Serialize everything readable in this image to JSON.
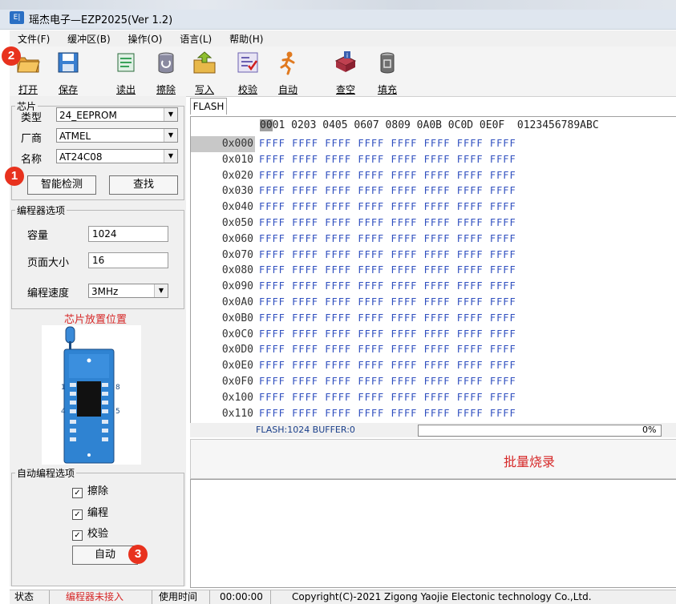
{
  "window": {
    "app_icon": "ezp-app-icon",
    "title": "瑶杰电子—EZP2025(Ver 1.2)"
  },
  "menu": [
    "文件(F)",
    "缓冲区(B)",
    "操作(O)",
    "语言(L)",
    "帮助(H)"
  ],
  "toolbar": [
    {
      "label": "打开",
      "icon": "open-folder-icon",
      "color": "#e8a13a"
    },
    {
      "label": "保存",
      "icon": "save-floppy-icon",
      "color": "#3a7fd0"
    },
    {
      "label": "读出",
      "icon": "read-chip-icon",
      "color": "#3aa25a"
    },
    {
      "label": "擦除",
      "icon": "erase-drum-icon",
      "color": "#8a8aa0"
    },
    {
      "label": "写入",
      "icon": "write-folder-icon",
      "color": "#8fbf30"
    },
    {
      "label": "校验",
      "icon": "verify-icon",
      "color": "#6a5fb0"
    },
    {
      "label": "自动",
      "icon": "auto-runner-icon",
      "color": "#e07a20"
    },
    {
      "label": "查空",
      "icon": "blank-check-book-icon",
      "color": "#a83040"
    },
    {
      "label": "填充",
      "icon": "fill-bin-icon",
      "color": "#707070"
    }
  ],
  "chip": {
    "group": "芯片",
    "type_label": "类型",
    "type_value": "24_EEPROM",
    "vendor_label": "厂商",
    "vendor_value": "ATMEL",
    "name_label": "名称",
    "name_value": "AT24C08",
    "detect_button": "智能检测",
    "find_button": "查找"
  },
  "prog_options": {
    "group": "编程器选项",
    "capacity_label": "容量",
    "capacity_value": "1024",
    "page_label": "页面大小",
    "page_value": "16",
    "speed_label": "编程速度",
    "speed_value": "3MHz"
  },
  "chip_position": {
    "title": "芯片放置位置",
    "pin_labels": [
      "1",
      "8",
      "4",
      "5"
    ]
  },
  "auto_options": {
    "group": "自动编程选项",
    "erase": "擦除",
    "erase_checked": true,
    "program": "编程",
    "program_checked": true,
    "verify": "校验",
    "verify_checked": true,
    "auto_button": "自动"
  },
  "badges": [
    "1",
    "2",
    "3"
  ],
  "tab": "FLASH",
  "hex": {
    "header_first": "00",
    "header_rest": "01 0203 0405 0607 0809 0A0B 0C0D 0E0F  0123456789ABC",
    "addresses": [
      "0x000",
      "0x010",
      "0x020",
      "0x030",
      "0x040",
      "0x050",
      "0x060",
      "0x070",
      "0x080",
      "0x090",
      "0x0A0",
      "0x0B0",
      "0x0C0",
      "0x0D0",
      "0x0E0",
      "0x0F0",
      "0x100",
      "0x110"
    ],
    "row_data": "FFFF FFFF FFFF FFFF FFFF FFFF FFFF FFFF"
  },
  "status_line": {
    "info": "FLASH:1024 BUFFER:0",
    "progress_text": "0%",
    "progress": 0
  },
  "batch_label": "批量烧录",
  "statusbar": {
    "state_label": "状态",
    "state_value": "编程器未接入",
    "time_label": "使用时间",
    "time_value": "00:00:00",
    "copyright": "Copyright(C)-2021 Zigong Yaojie Electonic technology Co.,Ltd."
  }
}
